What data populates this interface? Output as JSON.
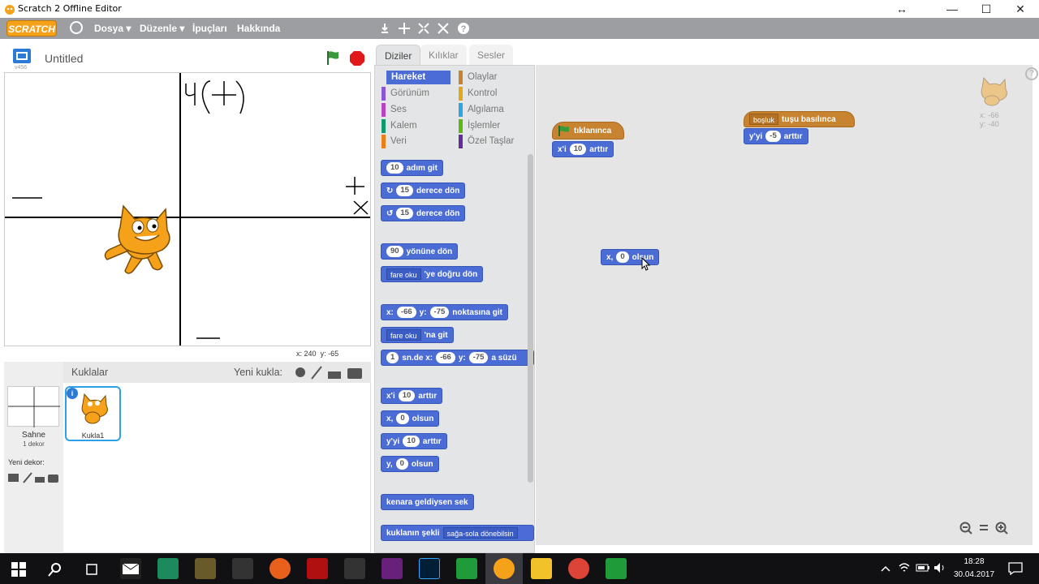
{
  "window": {
    "title": "Scratch 2 Offline Editor",
    "controls": {
      "resize": "↔",
      "minimize": "—",
      "maximize": "☐",
      "close": "✕"
    }
  },
  "menubar": {
    "logo": "SCRATCH",
    "items": [
      "Dosya ▾",
      "Düzenle ▾",
      "İpuçları",
      "Hakkında"
    ],
    "tools": [
      "duplicate-icon",
      "cut-icon",
      "grow-icon",
      "shrink-icon",
      "help-icon"
    ]
  },
  "stage": {
    "project_name": "Untitled",
    "version": "v456",
    "mouse_x_label": "x:",
    "mouse_x": "240",
    "mouse_y_label": "y:",
    "mouse_y": "-65",
    "drawing": {
      "y_label": "y (+)",
      "plus": "+",
      "x_mark": "x"
    }
  },
  "sprites": {
    "header": "Kuklalar",
    "new_sprite_label": "Yeni kukla:",
    "stage_label": "Sahne",
    "stage_sub": "1 dekor",
    "new_backdrop_label": "Yeni dekor:",
    "sprite_name": "Kukla1",
    "info": "i"
  },
  "tabs": [
    "Diziler",
    "Kılıklar",
    "Sesler"
  ],
  "categories": {
    "left": [
      {
        "label": "Hareket",
        "color": "#4a6cd4"
      },
      {
        "label": "Görünüm",
        "color": "#8a55d7"
      },
      {
        "label": "Ses",
        "color": "#bb42c3"
      },
      {
        "label": "Kalem",
        "color": "#0e9a6c"
      },
      {
        "label": "Veri",
        "color": "#ee7d16"
      }
    ],
    "right": [
      {
        "label": "Olaylar",
        "color": "#c88330"
      },
      {
        "label": "Kontrol",
        "color": "#e1a91a"
      },
      {
        "label": "Algılama",
        "color": "#2ca5e2"
      },
      {
        "label": "İşlemler",
        "color": "#5cb712"
      },
      {
        "label": "Özel Taşlar",
        "color": "#632d99"
      }
    ]
  },
  "palette_blocks": {
    "b1": {
      "v": "10",
      "t": "adım git"
    },
    "b2": {
      "v": "15",
      "t": "derece dön"
    },
    "b3": {
      "v": "15",
      "t": "derece dön"
    },
    "b4": {
      "v": "90",
      "t": "yönüne dön"
    },
    "b5": {
      "d": "fare oku",
      "t": "'ye doğru dön"
    },
    "b6": {
      "x": "x:",
      "xv": "-66",
      "y": "y:",
      "yv": "-75",
      "t": "noktasına git"
    },
    "b7": {
      "d": "fare oku",
      "t": "'na git"
    },
    "b8": {
      "v": "1",
      "a": "sn.de x:",
      "xv": "-66",
      "b": "y:",
      "yv": "-75",
      "t": "a süzü"
    },
    "b9": {
      "a": "x'i",
      "v": "10",
      "t": "arttır"
    },
    "b10": {
      "a": "x,",
      "v": "0",
      "t": "olsun"
    },
    "b11": {
      "a": "y'yi",
      "v": "10",
      "t": "arttır"
    },
    "b12": {
      "a": "y,",
      "v": "0",
      "t": "olsun"
    },
    "b13": {
      "t": "kenara geldiysen sek"
    },
    "b14": {
      "t": "kuklanın şekli",
      "d": "sağa-sola dönebilsin"
    }
  },
  "scripts": {
    "s1_hat": "tıklanınca",
    "s1_a": "x'i",
    "s1_v": "10",
    "s1_t": "arttır",
    "s2_d": "boşluk",
    "s2_hat": "tuşu basılınca",
    "s2_a": "y'yi",
    "s2_v": "-5",
    "s2_t": "arttır",
    "s3_a": "x,",
    "s3_v": "0",
    "s3_t": "olsun",
    "sprite_x": "x: -66",
    "sprite_y": "y: -40"
  },
  "taskbar": {
    "time": "18:28",
    "date": "30.04.2017"
  }
}
